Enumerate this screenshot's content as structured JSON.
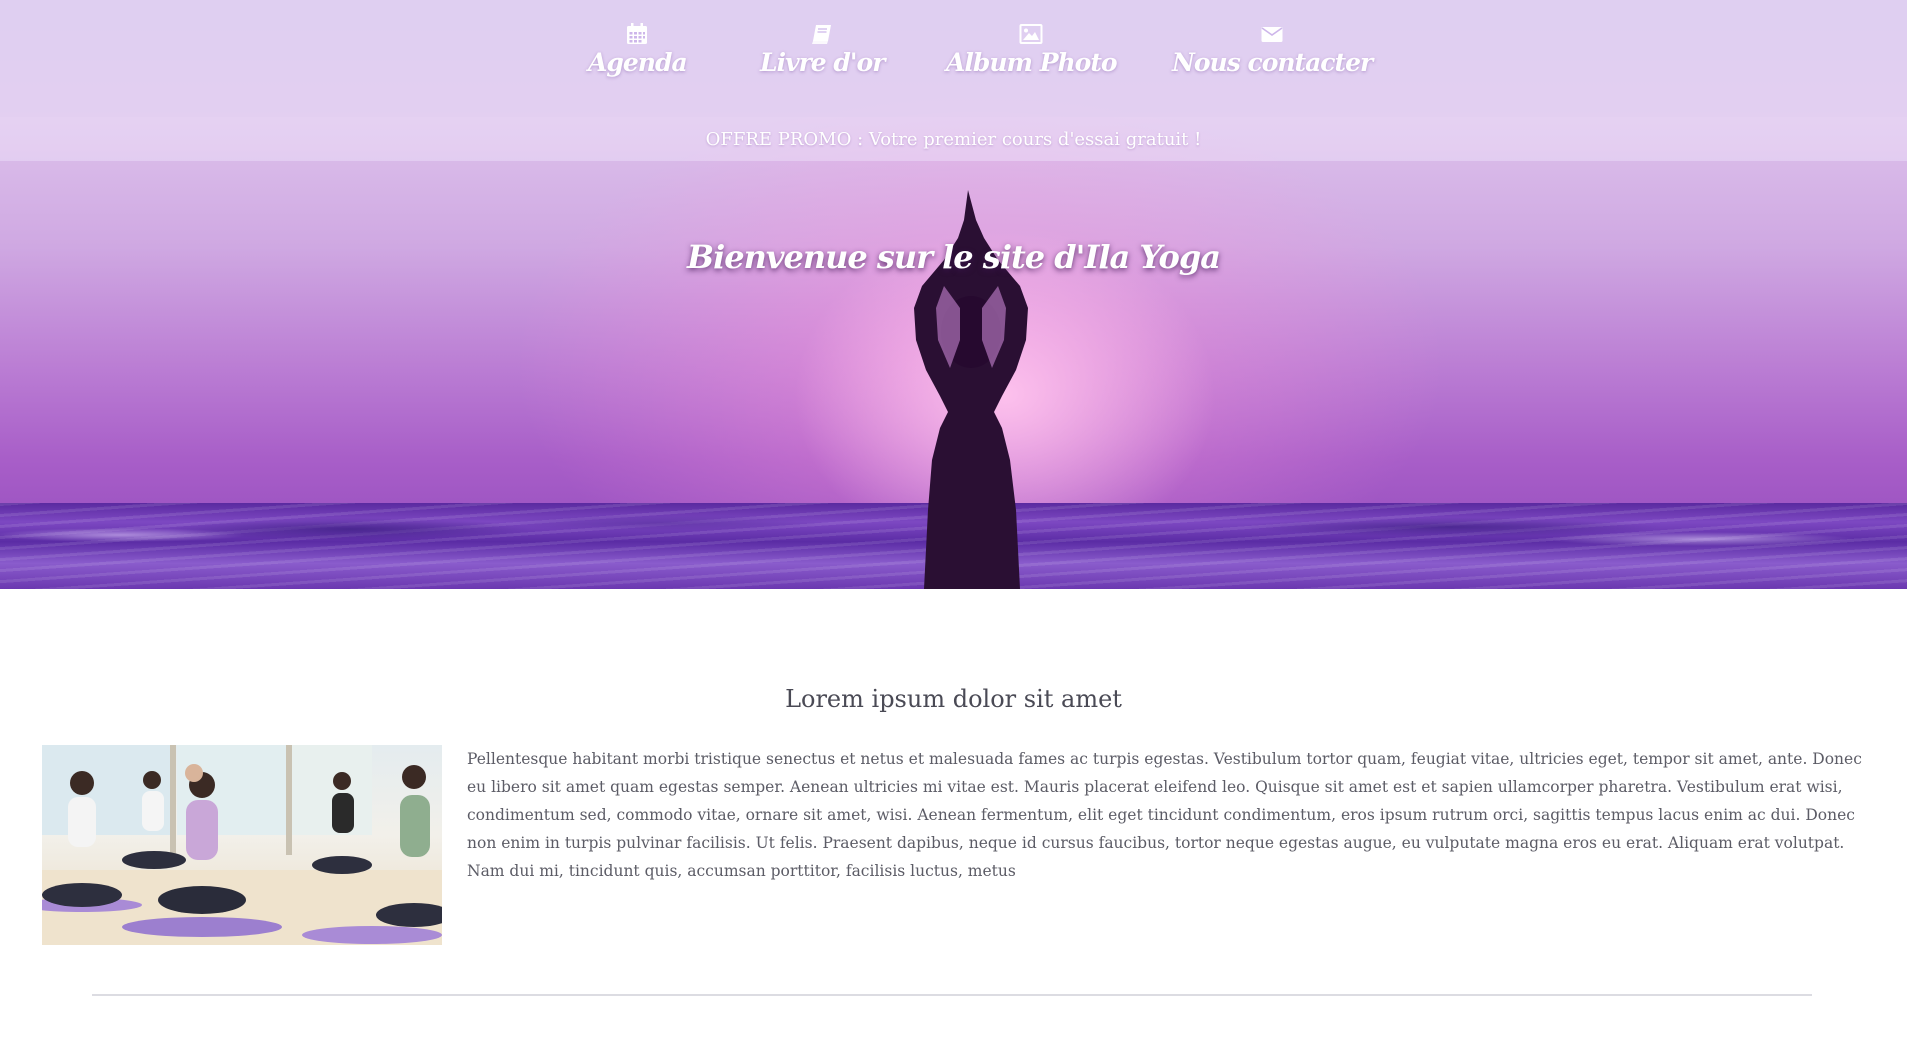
{
  "nav": {
    "items": [
      {
        "label": "Agenda",
        "icon": "calendar-icon"
      },
      {
        "label": "Livre d'or",
        "icon": "book-icon"
      },
      {
        "label": "Album Photo",
        "icon": "picture-icon"
      },
      {
        "label": "Nous contacter",
        "icon": "envelope-icon"
      }
    ]
  },
  "promo": {
    "text": "OFFRE PROMO : Votre premier cours d'essai gratuit !"
  },
  "hero": {
    "title": "Bienvenue sur le site d'Ila Yoga"
  },
  "intro": {
    "heading": "Lorem ipsum dolor sit amet",
    "paragraph": "Pellentesque habitant morbi tristique senectus et netus et malesuada fames ac turpis egestas. Vestibulum tortor quam, feugiat vitae, ultricies eget, tempor sit amet, ante. Donec eu libero sit amet quam egestas semper. Aenean ultricies mi vitae est. Mauris placerat eleifend leo. Quisque sit amet est et sapien ullamcorper pharetra. Vestibulum erat wisi, condimentum sed, commodo vitae, ornare sit amet, wisi. Aenean fermentum, elit eget tincidunt condimentum, eros ipsum rutrum orci, sagittis tempus lacus enim ac dui. Donec non enim in turpis pulvinar facilisis. Ut felis. Praesent dapibus, neque id cursus faucibus, tortor neque egestas augue, eu vulputate magna eros eu erat. Aliquam erat volutpat. Nam dui mi, tincidunt quis, accumsan porttitor, facilisis luctus, metus"
  },
  "colors": {
    "nav_overlay": "#e8daf6",
    "hero_sky_top": "#d4c0ec",
    "hero_sky_bottom": "#a85ec8",
    "ocean": "#5a2aa0",
    "heading_text": "#4a4a55",
    "body_text": "#5c5c66",
    "divider": "#dcdce2"
  }
}
